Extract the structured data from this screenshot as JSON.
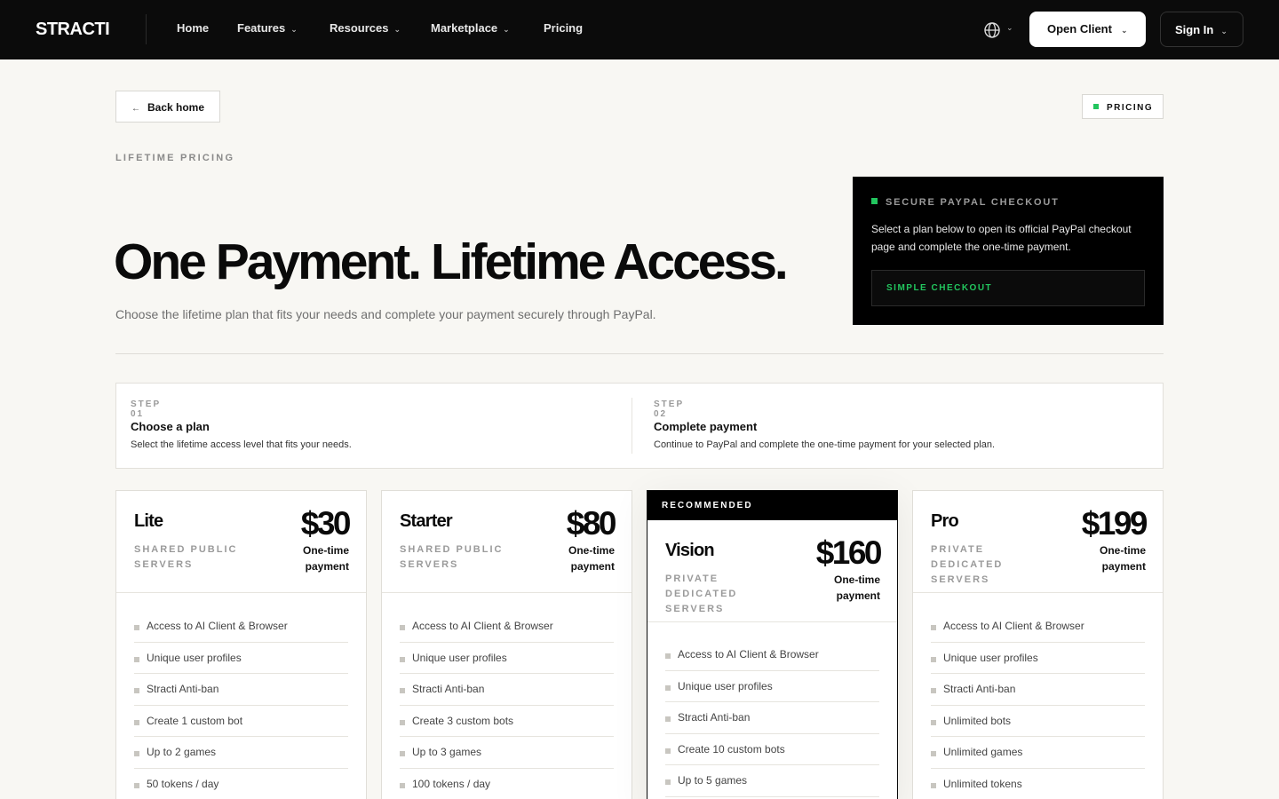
{
  "nav": {
    "logo": "STRACTI",
    "links": [
      {
        "label": "Home",
        "has_menu": false
      },
      {
        "label": "Features",
        "has_menu": true
      },
      {
        "label": "Resources",
        "has_menu": true
      },
      {
        "label": "Marketplace",
        "has_menu": true
      },
      {
        "label": "Pricing",
        "has_menu": false
      }
    ],
    "open_client": "Open Client",
    "sign_in": "Sign In"
  },
  "top": {
    "back": "Back home",
    "tag": "PRICING"
  },
  "hero": {
    "eyebrow": "LIFETIME PRICING",
    "title": "One Payment. Lifetime Access.",
    "subtitle": "Choose the lifetime plan that fits your needs and complete your payment securely through PayPal."
  },
  "checkout": {
    "heading": "SECURE PAYPAL CHECKOUT",
    "text": "Select a plan below to open its official PayPal checkout page and complete the one-time payment.",
    "button": "SIMPLE CHECKOUT"
  },
  "steps": [
    {
      "num": "STEP 01",
      "title": "Choose a plan",
      "desc": "Select the lifetime access level that fits your needs."
    },
    {
      "num": "STEP 02",
      "title": "Complete payment",
      "desc": "Continue to PayPal and complete the one-time payment for your selected plan."
    }
  ],
  "plans": [
    {
      "name": "Lite",
      "tier": "SHARED PUBLIC SERVERS",
      "price": "$30",
      "payment": "One-time payment",
      "recommended": false,
      "features": [
        "Access to AI Client & Browser",
        "Unique user profiles",
        "Stracti Anti-ban",
        "Create 1 custom bot",
        "Up to 2 games",
        "50 tokens / day",
        ""
      ]
    },
    {
      "name": "Starter",
      "tier": "SHARED PUBLIC SERVERS",
      "price": "$80",
      "payment": "One-time payment",
      "recommended": false,
      "features": [
        "Access to AI Client & Browser",
        "Unique user profiles",
        "Stracti Anti-ban",
        "Create 3 custom bots",
        "Up to 3 games",
        "100 tokens / day",
        ""
      ]
    },
    {
      "name": "Vision",
      "tier": "PRIVATE DEDICATED SERVERS",
      "price": "$160",
      "payment": "One-time payment",
      "recommended": true,
      "badge": "RECOMMENDED",
      "features": [
        "Access to AI Client & Browser",
        "Unique user profiles",
        "Stracti Anti-ban",
        "Create 10 custom bots",
        "Up to 5 games",
        ""
      ]
    },
    {
      "name": "Pro",
      "tier": "PRIVATE DEDICATED SERVERS",
      "price": "$199",
      "payment": "One-time payment",
      "recommended": false,
      "features": [
        "Access to AI Client & Browser",
        "Unique user profiles",
        "Stracti Anti-ban",
        "Unlimited bots",
        "Unlimited games",
        "Unlimited tokens",
        ""
      ]
    }
  ],
  "colors": {
    "accent": "#22c55e",
    "nav_bg": "#0b0b0b",
    "page_bg": "#f8f7f3"
  }
}
